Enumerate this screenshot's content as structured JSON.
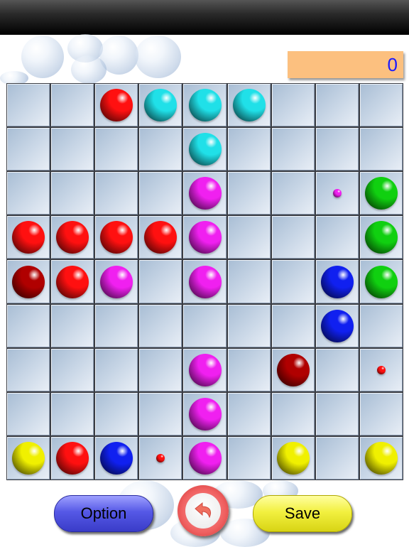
{
  "score": "0",
  "buttons": {
    "option": "Option",
    "save": "Save",
    "undo_icon": "undo-arrow-icon"
  },
  "board": {
    "rows": 9,
    "cols": 9,
    "balls": [
      {
        "row": 0,
        "col": 2,
        "color": "red",
        "size": "big"
      },
      {
        "row": 0,
        "col": 3,
        "color": "cyan",
        "size": "big"
      },
      {
        "row": 0,
        "col": 4,
        "color": "cyan",
        "size": "big"
      },
      {
        "row": 0,
        "col": 5,
        "color": "cyan",
        "size": "big"
      },
      {
        "row": 1,
        "col": 4,
        "color": "cyan",
        "size": "big"
      },
      {
        "row": 2,
        "col": 4,
        "color": "magenta",
        "size": "big"
      },
      {
        "row": 2,
        "col": 7,
        "color": "magenta",
        "size": "small"
      },
      {
        "row": 2,
        "col": 8,
        "color": "green",
        "size": "big"
      },
      {
        "row": 3,
        "col": 0,
        "color": "red",
        "size": "big"
      },
      {
        "row": 3,
        "col": 1,
        "color": "red",
        "size": "big"
      },
      {
        "row": 3,
        "col": 2,
        "color": "red",
        "size": "big"
      },
      {
        "row": 3,
        "col": 3,
        "color": "red",
        "size": "big"
      },
      {
        "row": 3,
        "col": 4,
        "color": "magenta",
        "size": "big"
      },
      {
        "row": 3,
        "col": 8,
        "color": "green",
        "size": "big"
      },
      {
        "row": 4,
        "col": 0,
        "color": "darkred",
        "size": "big"
      },
      {
        "row": 4,
        "col": 1,
        "color": "red",
        "size": "big"
      },
      {
        "row": 4,
        "col": 2,
        "color": "magenta",
        "size": "big"
      },
      {
        "row": 4,
        "col": 4,
        "color": "magenta",
        "size": "big"
      },
      {
        "row": 4,
        "col": 7,
        "color": "blue",
        "size": "big"
      },
      {
        "row": 4,
        "col": 8,
        "color": "green",
        "size": "big"
      },
      {
        "row": 5,
        "col": 7,
        "color": "blue",
        "size": "big"
      },
      {
        "row": 6,
        "col": 4,
        "color": "magenta",
        "size": "big"
      },
      {
        "row": 6,
        "col": 6,
        "color": "darkred",
        "size": "big"
      },
      {
        "row": 6,
        "col": 8,
        "color": "red",
        "size": "small"
      },
      {
        "row": 7,
        "col": 4,
        "color": "magenta",
        "size": "big"
      },
      {
        "row": 8,
        "col": 0,
        "color": "yellow",
        "size": "big"
      },
      {
        "row": 8,
        "col": 1,
        "color": "red",
        "size": "big"
      },
      {
        "row": 8,
        "col": 2,
        "color": "blue",
        "size": "big"
      },
      {
        "row": 8,
        "col": 3,
        "color": "red",
        "size": "small"
      },
      {
        "row": 8,
        "col": 4,
        "color": "magenta",
        "size": "big"
      },
      {
        "row": 8,
        "col": 6,
        "color": "yellow",
        "size": "big"
      },
      {
        "row": 8,
        "col": 8,
        "color": "yellow",
        "size": "big"
      }
    ]
  },
  "colors": {
    "red": "#ff1010",
    "darkred": "#b00000",
    "cyan": "#20e0e8",
    "magenta": "#f020f0",
    "green": "#10d010",
    "blue": "#1020f0",
    "yellow": "#f0f000",
    "score_bg": "#fcc07f",
    "score_text": "#1a1aff"
  }
}
